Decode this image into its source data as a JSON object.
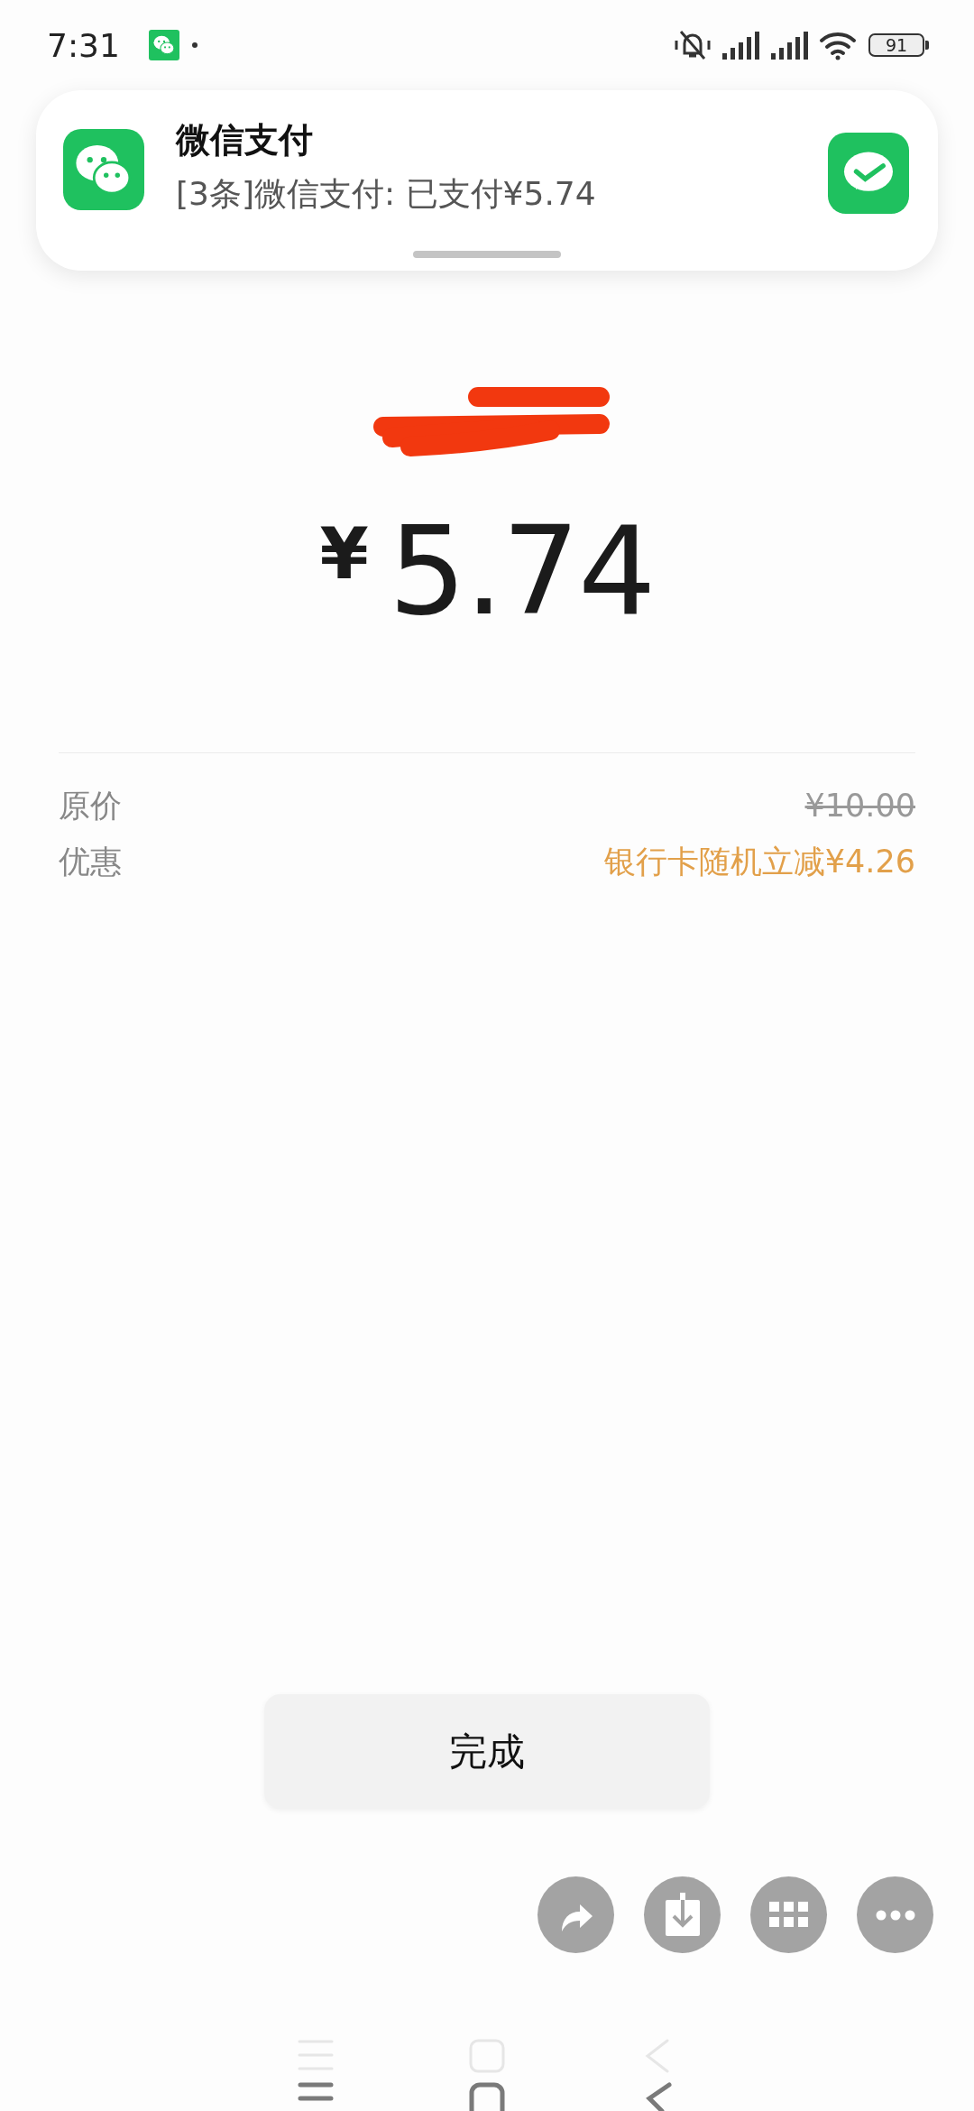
{
  "status_bar": {
    "time": "7:31",
    "battery": "91"
  },
  "notification": {
    "app": "微信支付",
    "message": "[3条]微信支付: 已支付¥5.74"
  },
  "payment": {
    "currency": "¥",
    "amount": "5.74"
  },
  "details": [
    {
      "label": "原价",
      "value": "¥10.00",
      "kind": "original"
    },
    {
      "label": "优惠",
      "value": "银行卡随机立减¥4.26",
      "kind": "discount"
    }
  ],
  "done_button": "完成"
}
